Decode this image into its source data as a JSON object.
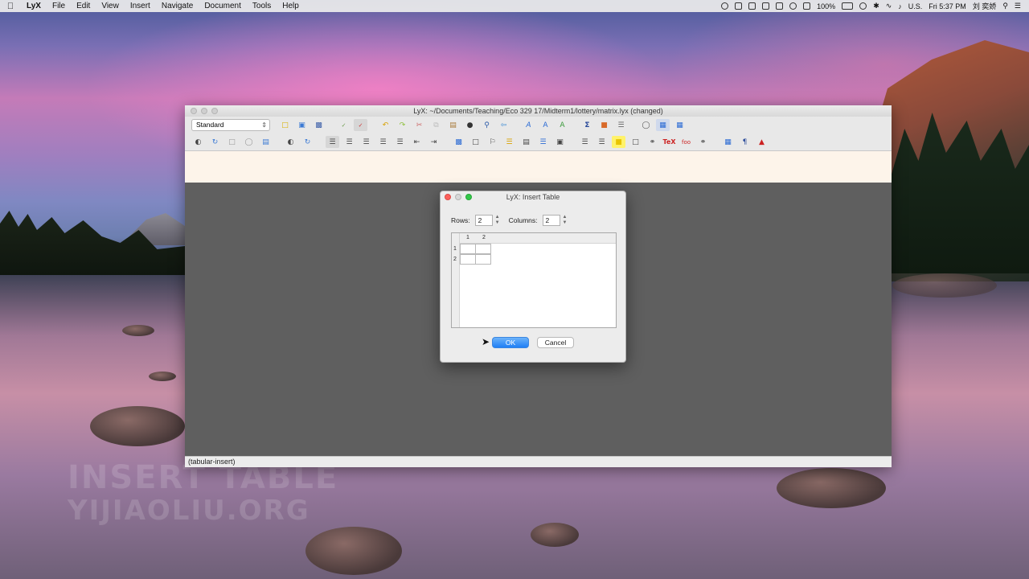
{
  "menubar": {
    "app_name": "LyX",
    "items": [
      "File",
      "Edit",
      "View",
      "Insert",
      "Navigate",
      "Document",
      "Tools",
      "Help"
    ],
    "battery": "100%",
    "input_source": "U.S.",
    "clock": "Fri 5:37 PM",
    "user": "刘 奕娇"
  },
  "window": {
    "title": "LyX: ~/Documents/Teaching/Eco 329 17/Midterm1/lottery/matrix.lyx (changed)",
    "layout_value": "Standard",
    "status_text": "(tabular-insert)"
  },
  "dialog": {
    "title": "LyX: Insert Table",
    "rows_label": "Rows:",
    "rows_value": "2",
    "columns_label": "Columns:",
    "columns_value": "2",
    "col_headers": [
      "1",
      "2"
    ],
    "row_headers": [
      "1",
      "2"
    ],
    "ok_label": "OK",
    "cancel_label": "Cancel"
  },
  "watermark": {
    "line1": "INSERT TABLE",
    "line2": "YIJIAOLIU.ORG"
  }
}
